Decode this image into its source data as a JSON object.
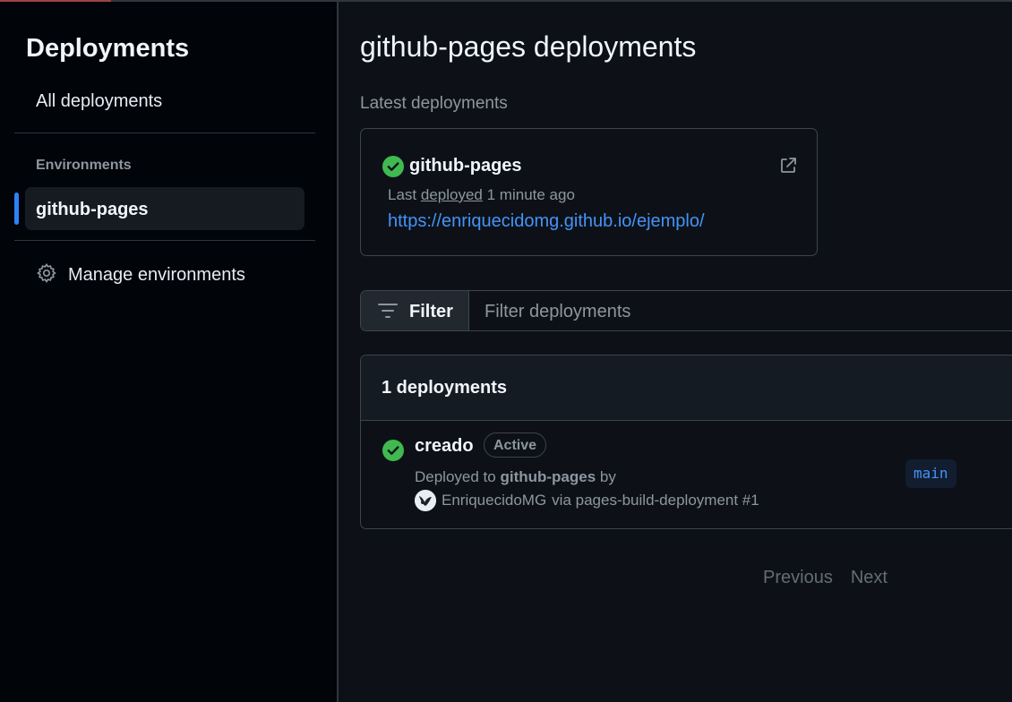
{
  "sidebar": {
    "title": "Deployments",
    "all_deployments": "All deployments",
    "environments_heading": "Environments",
    "environments": [
      {
        "label": "github-pages",
        "selected": true
      }
    ],
    "manage_environments": "Manage environments"
  },
  "main": {
    "title": "github-pages deployments",
    "latest_heading": "Latest deployments",
    "latest_card": {
      "name": "github-pages",
      "status": "success",
      "last_prefix": "Last",
      "last_link": "deployed",
      "last_time": "1 minute ago",
      "url": "https://enriquecidomg.github.io/ejemplo/"
    },
    "filter": {
      "button_label": "Filter",
      "placeholder": "Filter deployments"
    },
    "list": {
      "count_label": "1 deployments",
      "rows": [
        {
          "name": "creado",
          "badge": "Active",
          "deployed_to_prefix": "Deployed to",
          "environment": "github-pages",
          "by": "by",
          "author": "EnriquecidoMG",
          "via": "via pages-build-deployment #1",
          "branch": "main"
        }
      ]
    },
    "pagination": {
      "previous": "Previous",
      "next": "Next"
    }
  },
  "colors": {
    "background": "#0d1117",
    "sidebar_bg": "#010409",
    "accent": "#2f81f7",
    "link": "#4493f8",
    "success": "#3fb950"
  },
  "icons": [
    "check-circle-fill-icon",
    "link-external-icon",
    "filter-icon",
    "gear-icon",
    "avatar"
  ]
}
